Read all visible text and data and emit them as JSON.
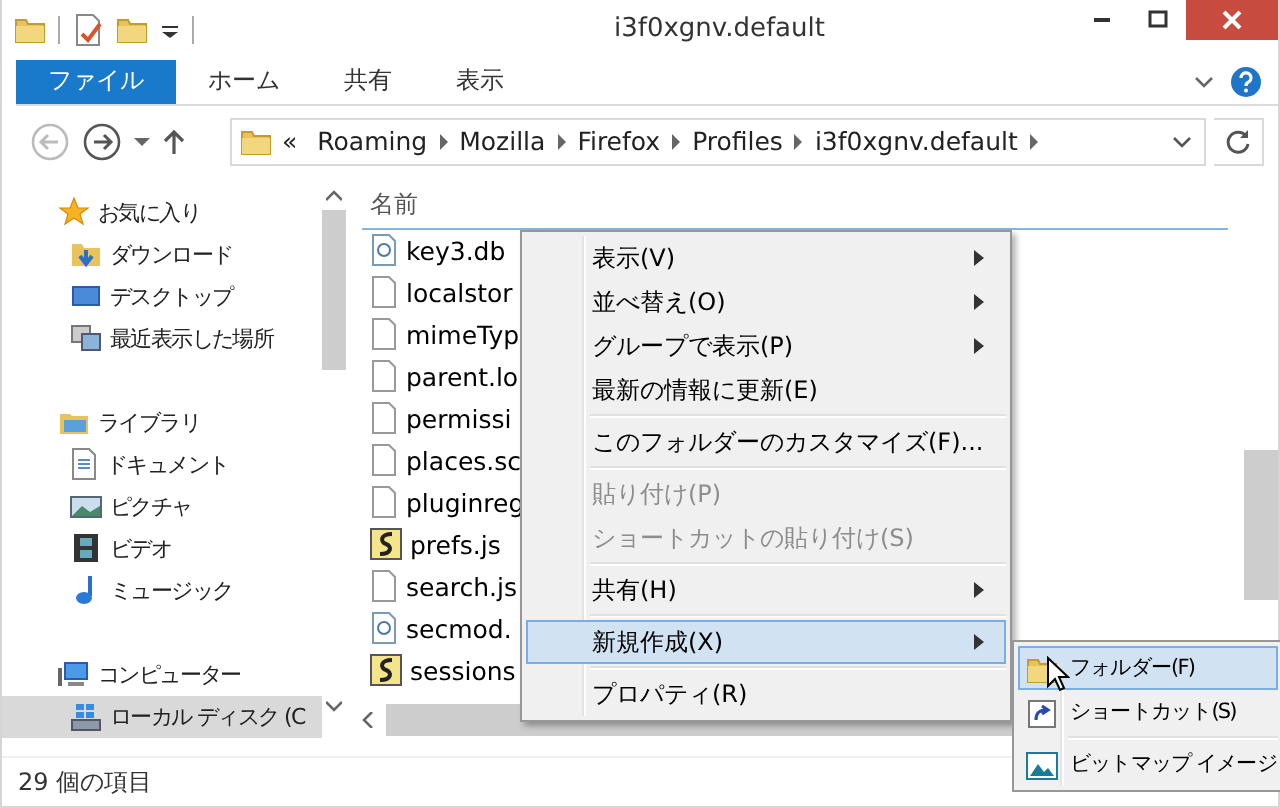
{
  "window": {
    "title": "i3f0xgnv.default"
  },
  "ribbon_tabs": [
    {
      "label": "ファイル",
      "selected": true
    },
    {
      "label": "ホーム",
      "selected": false
    },
    {
      "label": "共有",
      "selected": false
    },
    {
      "label": "表示",
      "selected": false
    }
  ],
  "address": {
    "overflow": "«",
    "crumbs": [
      "Roaming",
      "Mozilla",
      "Firefox",
      "Profiles",
      "i3f0xgnv.default"
    ]
  },
  "nav": [
    {
      "label": "お気に入り",
      "kind": "star",
      "selected": false,
      "children": [
        {
          "label": "ダウンロード",
          "kind": "download",
          "selected": false
        },
        {
          "label": "デスクトップ",
          "kind": "desktop",
          "selected": false
        },
        {
          "label": "最近表示した場所",
          "kind": "recent",
          "selected": false
        }
      ]
    },
    {
      "label": "ライブラリ",
      "kind": "library",
      "selected": false,
      "children": [
        {
          "label": "ドキュメント",
          "kind": "document",
          "selected": false
        },
        {
          "label": "ピクチャ",
          "kind": "picture",
          "selected": false
        },
        {
          "label": "ビデオ",
          "kind": "video",
          "selected": false
        },
        {
          "label": "ミュージック",
          "kind": "music",
          "selected": false
        }
      ]
    },
    {
      "label": "コンピューター",
      "kind": "computer",
      "selected": false,
      "children": [
        {
          "label": "ローカル ディスク (C",
          "kind": "disk",
          "selected": true
        }
      ]
    }
  ],
  "columns": [
    "名前"
  ],
  "files": [
    {
      "name": "key3.db",
      "kind": "db"
    },
    {
      "name": "localstor",
      "kind": "file"
    },
    {
      "name": "mimeTyp",
      "kind": "file"
    },
    {
      "name": "parent.lo",
      "kind": "file"
    },
    {
      "name": "permissi",
      "kind": "file"
    },
    {
      "name": "places.sc",
      "kind": "file"
    },
    {
      "name": "pluginreg",
      "kind": "file"
    },
    {
      "name": "prefs.js",
      "kind": "script"
    },
    {
      "name": "search.js",
      "kind": "file"
    },
    {
      "name": "secmod.",
      "kind": "db"
    },
    {
      "name": "sessions",
      "kind": "script"
    }
  ],
  "context_menu": [
    {
      "kind": "item",
      "label": "表示(V)",
      "submenu": true,
      "disabled": false,
      "selected": false
    },
    {
      "kind": "item",
      "label": "並べ替え(O)",
      "submenu": true,
      "disabled": false,
      "selected": false
    },
    {
      "kind": "item",
      "label": "グループで表示(P)",
      "submenu": true,
      "disabled": false,
      "selected": false
    },
    {
      "kind": "item",
      "label": "最新の情報に更新(E)",
      "submenu": false,
      "disabled": false,
      "selected": false
    },
    {
      "kind": "separator"
    },
    {
      "kind": "item",
      "label": "このフォルダーのカスタマイズ(F)...",
      "submenu": false,
      "disabled": false,
      "selected": false
    },
    {
      "kind": "separator"
    },
    {
      "kind": "item",
      "label": "貼り付け(P)",
      "submenu": false,
      "disabled": true,
      "selected": false
    },
    {
      "kind": "item",
      "label": "ショートカットの貼り付け(S)",
      "submenu": false,
      "disabled": true,
      "selected": false
    },
    {
      "kind": "separator"
    },
    {
      "kind": "item",
      "label": "共有(H)",
      "submenu": true,
      "disabled": false,
      "selected": false
    },
    {
      "kind": "separator"
    },
    {
      "kind": "item",
      "label": "新規作成(X)",
      "submenu": true,
      "disabled": false,
      "selected": true
    },
    {
      "kind": "separator"
    },
    {
      "kind": "item",
      "label": "プロパティ(R)",
      "submenu": false,
      "disabled": false,
      "selected": false
    }
  ],
  "submenu": [
    {
      "kind": "folder",
      "label": "フォルダー(F)",
      "selected": true
    },
    {
      "kind": "shortcut",
      "label": "ショートカット(S)",
      "selected": false
    },
    {
      "kind": "separator"
    },
    {
      "kind": "bitmap",
      "label": "ビットマップ イメージ",
      "selected": false
    }
  ],
  "status_bar": {
    "count": "29 個の項目"
  }
}
